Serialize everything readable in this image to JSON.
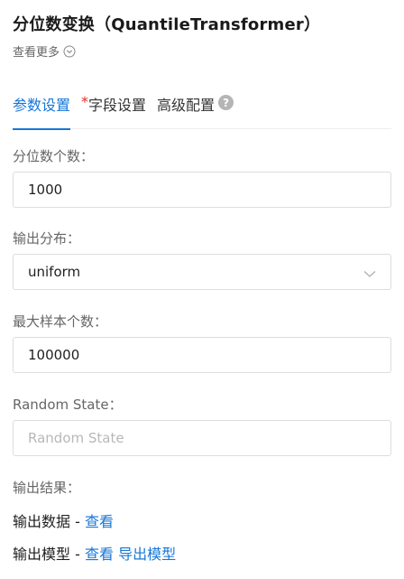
{
  "header": {
    "title": "分位数变换（QuantileTransformer）",
    "more_label": "查看更多"
  },
  "tabs": [
    {
      "label": "参数设置",
      "required": false
    },
    {
      "label": "字段设置",
      "required": true,
      "marker": "*"
    },
    {
      "label": "高级配置",
      "required": false,
      "help": "?"
    }
  ],
  "fields": {
    "quantiles": {
      "label": "分位数个数：",
      "value": "1000"
    },
    "output_distribution": {
      "label": "输出分布：",
      "value": "uniform"
    },
    "max_samples": {
      "label": "最大样本个数：",
      "value": "100000"
    },
    "random_state": {
      "label": "Random State：",
      "value": "",
      "placeholder": "Random State"
    }
  },
  "output": {
    "label": "输出结果：",
    "data_line": {
      "prefix": "输出数据 - ",
      "view_link": "查看"
    },
    "model_line": {
      "prefix": "输出模型 - ",
      "view_link": "查看",
      "export_link": "导出模型"
    }
  },
  "colors": {
    "accent": "#1677d7",
    "required": "#e02e24"
  },
  "icons": {
    "more": "chevron-down-circle-icon",
    "select": "chevron-down-icon",
    "help": "help-circle-icon"
  }
}
